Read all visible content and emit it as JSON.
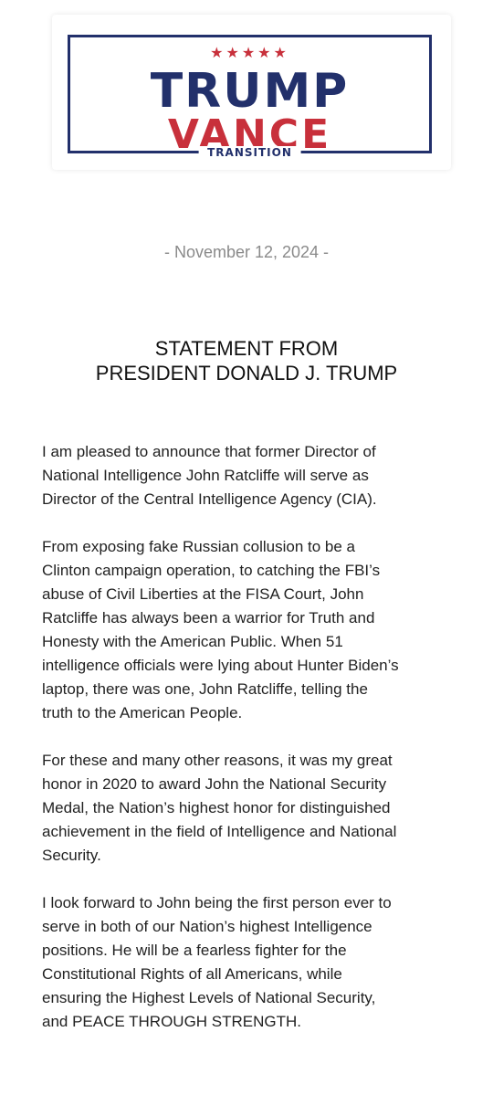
{
  "logo": {
    "stars": "★★★★★",
    "line1": "TRUMP",
    "line2": "VANCE",
    "tagline": "TRANSITION",
    "colors": {
      "navy": "#22306b",
      "red": "#c8303b"
    }
  },
  "date": "- November 12, 2024 -",
  "title": {
    "line1": "STATEMENT FROM",
    "line2": "PRESIDENT DONALD J. TRUMP"
  },
  "paragraphs": [
    {
      "lines": [
        "I am pleased to announce that former Director of",
        "National Intelligence John Ratcliffe will serve as",
        "Director of the Central Intelligence Agency (CIA)."
      ]
    },
    {
      "lines": [
        "From exposing fake Russian collusion to be a",
        "Clinton campaign operation, to catching the FBI’s",
        "abuse of Civil Liberties at the FISA Court, John",
        "Ratcliffe has always been a warrior for Truth and",
        "Honesty with the American Public. When 51",
        "intelligence officials were lying about Hunter Biden’s",
        "laptop, there was one, John Ratcliffe, telling the",
        "truth to the American People."
      ]
    },
    {
      "lines": [
        "For these and many other reasons, it was my great",
        "honor in 2020 to award John the National Security",
        "Medal, the Nation’s highest honor for distinguished",
        "achievement in the field of Intelligence and National",
        "Security."
      ]
    },
    {
      "lines": [
        "I look forward to John being the first person ever to",
        "serve in both of our Nation’s highest Intelligence",
        "positions. He will be a fearless fighter for the",
        "Constitutional Rights of all Americans, while",
        "ensuring the Highest Levels of National Security,",
        "and PEACE THROUGH STRENGTH."
      ]
    }
  ]
}
